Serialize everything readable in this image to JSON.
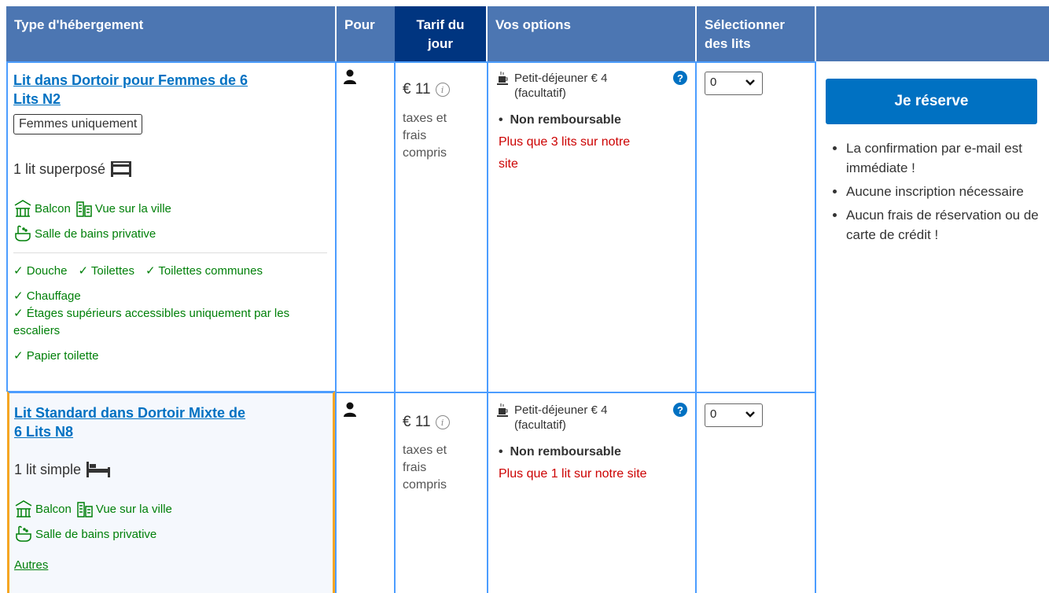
{
  "header": {
    "type": "Type d'hébergement",
    "pour": "Pour",
    "tarif": "Tarif du jour",
    "options": "Vos options",
    "select": "Sélectionner des lits"
  },
  "rows": [
    {
      "title_line1": "Lit dans Dortoir pour Femmes de 6",
      "title_line2": "Lits N2",
      "badge": "Femmes uniquement",
      "bed": "1 lit superposé",
      "facility_balcon": "Balcon",
      "facility_vue": "Vue sur la ville",
      "facility_sdb": "Salle de bains privative",
      "checks": [
        "Douche",
        "Toilettes",
        "Toilettes communes",
        "Chauffage",
        "Étages supérieurs accessibles uniquement par les escaliers",
        "Papier toilette"
      ],
      "price": "€ 11",
      "tax_line1": "taxes et",
      "tax_line2": "frais",
      "tax_line3": "compris",
      "opt_line1": "Petit-déjeuner € 4",
      "opt_line2": "(facultatif)",
      "nonref": "Non remboursable",
      "avail_line1": "Plus que 3 lits sur notre",
      "avail_line2": "site",
      "select_value": "0"
    },
    {
      "title_line1": "Lit Standard dans Dortoir Mixte de",
      "title_line2": "6 Lits N8",
      "bed": "1 lit simple",
      "facility_balcon": "Balcon",
      "facility_vue": "Vue sur la ville",
      "facility_sdb": "Salle de bains privative",
      "more": "Autres",
      "price": "€ 11",
      "tax_line1": "taxes et",
      "tax_line2": "frais",
      "tax_line3": "compris",
      "opt_line1": "Petit-déjeuner € 4",
      "opt_line2": "(facultatif)",
      "nonref": "Non remboursable",
      "avail_line1": "Plus que 1 lit sur notre site",
      "select_value": "0"
    }
  ],
  "reserve": {
    "button": "Je réserve",
    "bullets": [
      "La confirmation par e-mail est immédiate !",
      "Aucune inscription nécessaire",
      "Aucun frais de réservation ou de carte de crédit !"
    ]
  }
}
